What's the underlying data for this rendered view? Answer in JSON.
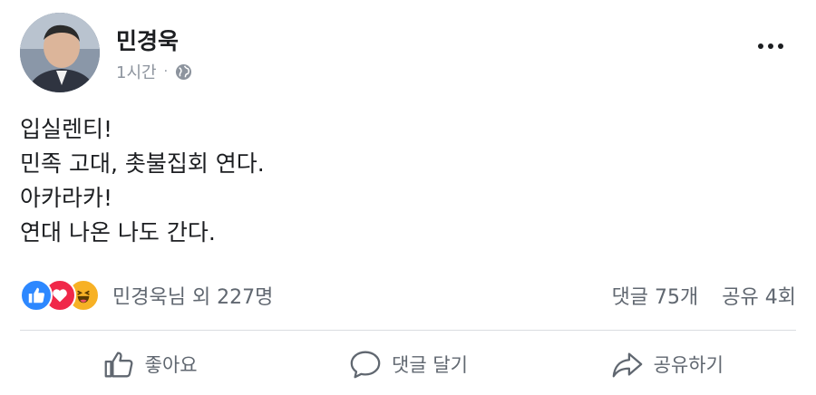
{
  "post": {
    "author": "민경욱",
    "time": "1시간",
    "separator": "·",
    "text_lines": [
      "입실렌티!",
      "민족 고대, 촛불집회 연다.",
      "아카라카!",
      "연대 나온 나도 간다."
    ]
  },
  "reactions": {
    "icons": [
      "like-icon",
      "love-icon",
      "haha-icon"
    ],
    "summary": "민경욱님 외 227명",
    "comments": "댓글 75개",
    "shares": "공유 4회"
  },
  "actions": {
    "like": "좋아요",
    "comment": "댓글 달기",
    "share": "공유하기"
  },
  "colors": {
    "like": "#2d88ff",
    "love": "#f02849",
    "haha": "#f7b125",
    "secondary_text": "#606770"
  }
}
